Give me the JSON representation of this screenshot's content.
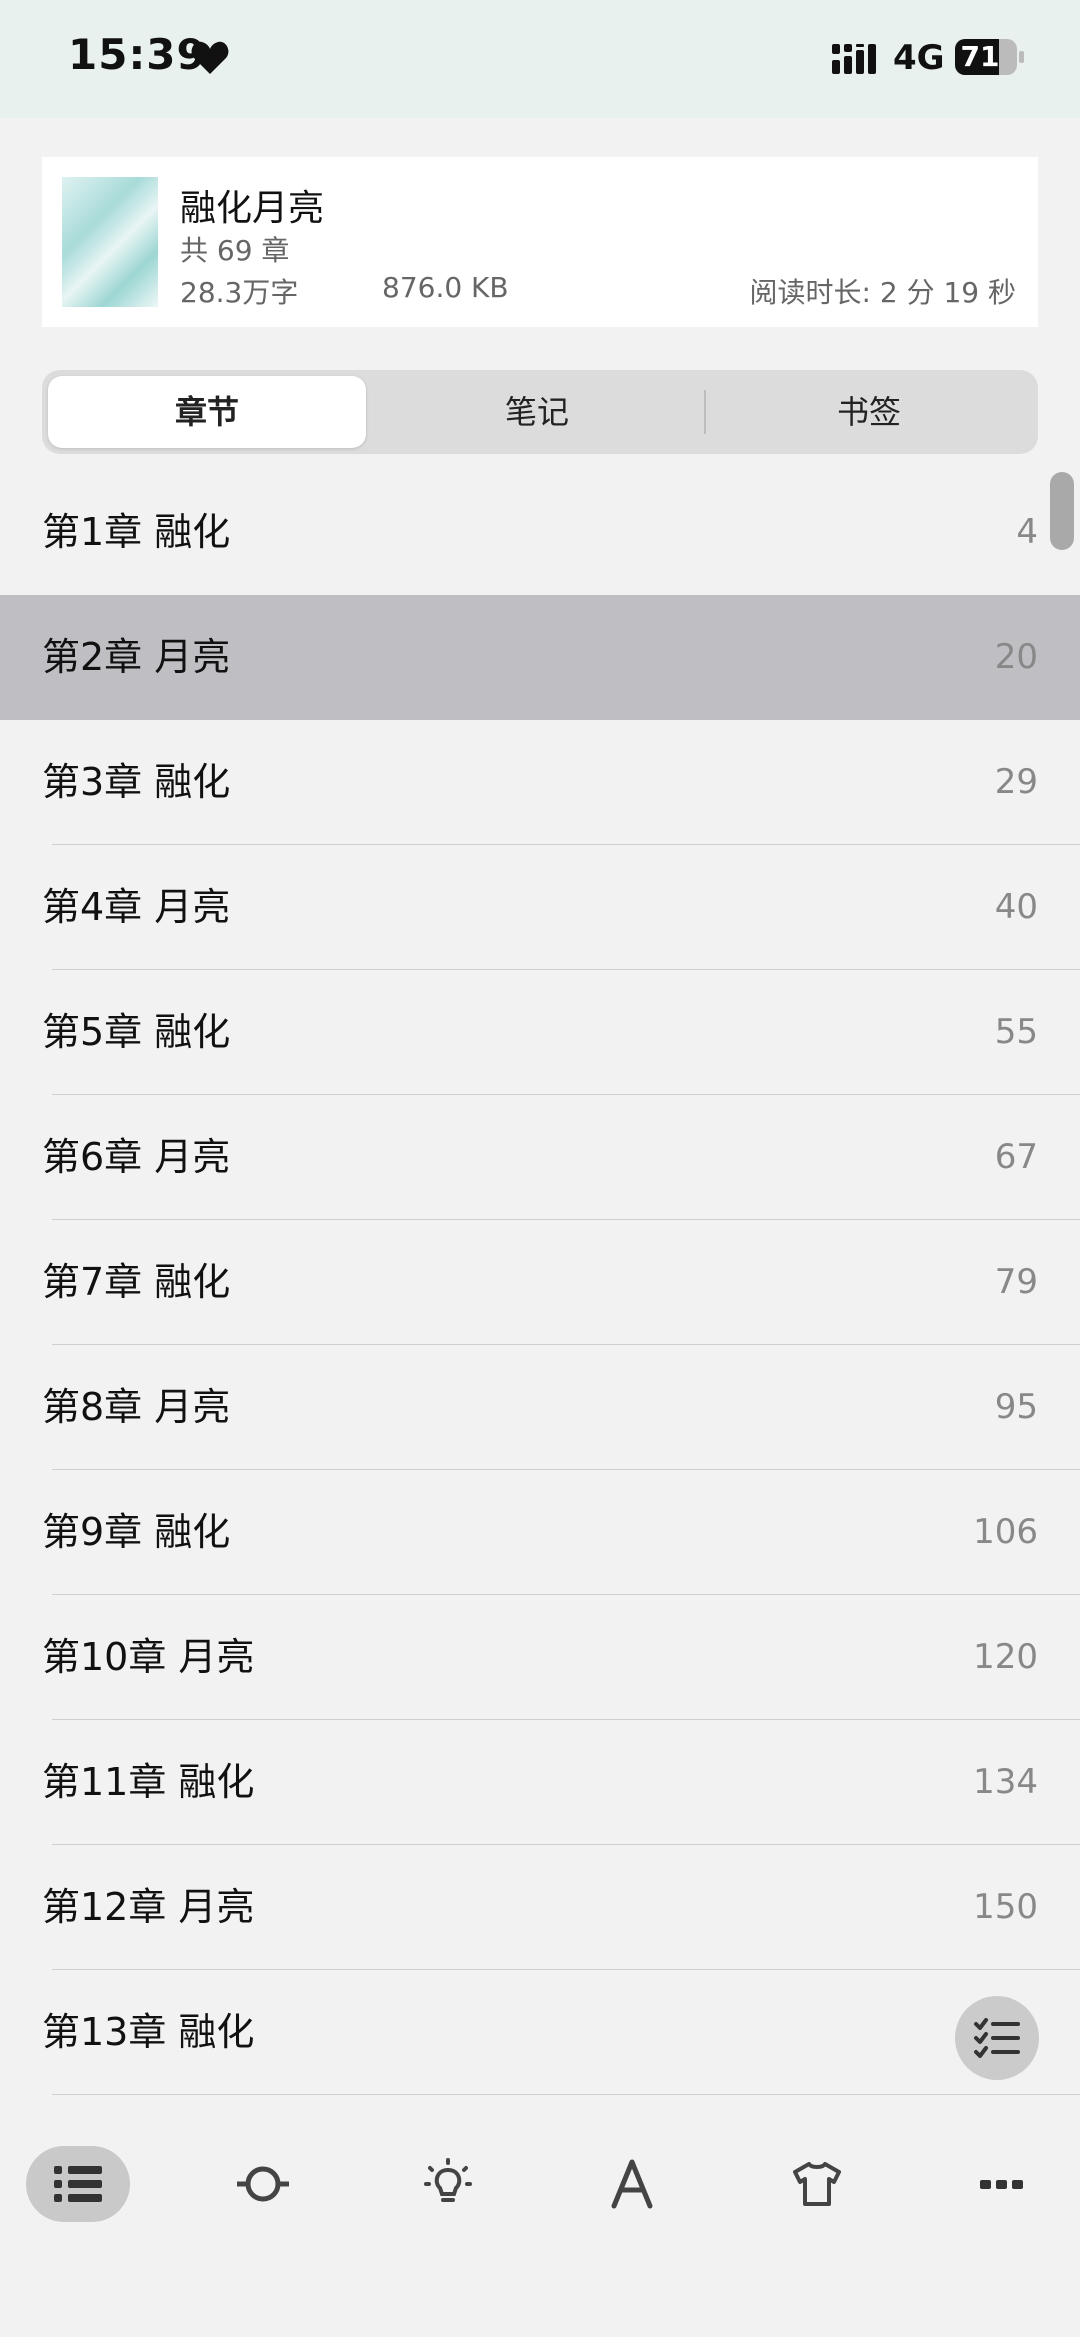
{
  "status_bar": {
    "time": "15:39",
    "network": "4G",
    "battery_percent": "71",
    "battery_level": 0.71,
    "icons": [
      "heart-icon",
      "signal-icon",
      "battery-icon"
    ]
  },
  "book": {
    "title": "融化月亮",
    "chapter_count": "共 69 章",
    "word_count": "28.3万字",
    "file_size": "876.0 KB",
    "read_time": "阅读时长: 2 分 19 秒"
  },
  "tabs": [
    {
      "label": "章节",
      "active": true
    },
    {
      "label": "笔记",
      "active": false
    },
    {
      "label": "书签",
      "active": false
    }
  ],
  "chapters": [
    {
      "title": "第1章 融化",
      "page": "4"
    },
    {
      "title": "第2章 月亮",
      "page": "20",
      "selected": true
    },
    {
      "title": "第3章 融化",
      "page": "29"
    },
    {
      "title": "第4章 月亮",
      "page": "40"
    },
    {
      "title": "第5章 融化",
      "page": "55"
    },
    {
      "title": "第6章 月亮",
      "page": "67"
    },
    {
      "title": "第7章 融化",
      "page": "79"
    },
    {
      "title": "第8章 月亮",
      "page": "95"
    },
    {
      "title": "第9章 融化",
      "page": "106"
    },
    {
      "title": "第10章 月亮",
      "page": "120"
    },
    {
      "title": "第11章 融化",
      "page": "134"
    },
    {
      "title": "第12章 月亮",
      "page": "150"
    },
    {
      "title": "第13章 融化",
      "page": ""
    }
  ],
  "fab_icon": "checklist-icon",
  "toolbar": {
    "items": [
      "list-icon",
      "progress-icon",
      "brightness-icon",
      "font-icon",
      "theme-icon",
      "more-icon"
    ]
  }
}
